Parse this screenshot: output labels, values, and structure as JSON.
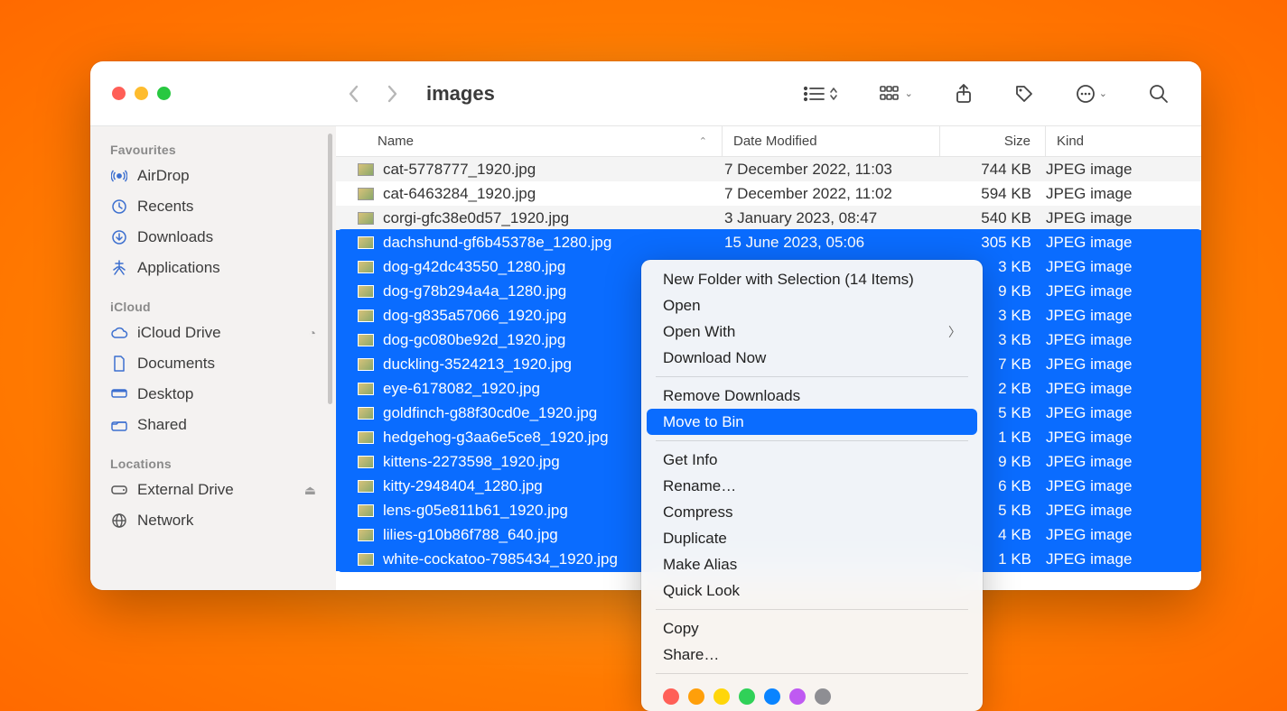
{
  "window": {
    "title": "images"
  },
  "columns": {
    "name": "Name",
    "date": "Date Modified",
    "size": "Size",
    "kind": "Kind"
  },
  "sidebar": {
    "favourites": {
      "header": "Favourites",
      "items": [
        {
          "label": "AirDrop",
          "icon": "airdrop"
        },
        {
          "label": "Recents",
          "icon": "clock"
        },
        {
          "label": "Downloads",
          "icon": "download"
        },
        {
          "label": "Applications",
          "icon": "apps"
        }
      ]
    },
    "icloud": {
      "header": "iCloud",
      "items": [
        {
          "label": "iCloud Drive",
          "icon": "cloud",
          "aux": "◔"
        },
        {
          "label": "Documents",
          "icon": "doc"
        },
        {
          "label": "Desktop",
          "icon": "desktop"
        },
        {
          "label": "Shared",
          "icon": "shared"
        }
      ]
    },
    "locations": {
      "header": "Locations",
      "items": [
        {
          "label": "External Drive",
          "icon": "drive",
          "aux": "⏏"
        },
        {
          "label": "Network",
          "icon": "globe"
        }
      ]
    }
  },
  "files": [
    {
      "name": "cat-5778777_1920.jpg",
      "date": "7 December 2022, 11:03",
      "size": "744 KB",
      "kind": "JPEG image",
      "sel": false,
      "alt": true
    },
    {
      "name": "cat-6463284_1920.jpg",
      "date": "7 December 2022, 11:02",
      "size": "594 KB",
      "kind": "JPEG image",
      "sel": false,
      "alt": false
    },
    {
      "name": "corgi-gfc38e0d57_1920.jpg",
      "date": "3 January 2023, 08:47",
      "size": "540 KB",
      "kind": "JPEG image",
      "sel": false,
      "alt": true
    },
    {
      "name": "dachshund-gf6b45378e_1280.jpg",
      "date": "15 June 2023, 05:06",
      "size": "305 KB",
      "kind": "JPEG image",
      "sel": true
    },
    {
      "name": "dog-g42dc43550_1280.jpg",
      "date": "",
      "size": "3 KB",
      "kind": "JPEG image",
      "sel": true
    },
    {
      "name": "dog-g78b294a4a_1280.jpg",
      "date": "",
      "size": "9 KB",
      "kind": "JPEG image",
      "sel": true
    },
    {
      "name": "dog-g835a57066_1920.jpg",
      "date": "",
      "size": "3 KB",
      "kind": "JPEG image",
      "sel": true
    },
    {
      "name": "dog-gc080be92d_1920.jpg",
      "date": "",
      "size": "3 KB",
      "kind": "JPEG image",
      "sel": true
    },
    {
      "name": "duckling-3524213_1920.jpg",
      "date": "",
      "size": "7 KB",
      "kind": "JPEG image",
      "sel": true
    },
    {
      "name": "eye-6178082_1920.jpg",
      "date": "",
      "size": "2 KB",
      "kind": "JPEG image",
      "sel": true
    },
    {
      "name": "goldfinch-g88f30cd0e_1920.jpg",
      "date": "",
      "size": "5 KB",
      "kind": "JPEG image",
      "sel": true
    },
    {
      "name": "hedgehog-g3aa6e5ce8_1920.jpg",
      "date": "",
      "size": "1 KB",
      "kind": "JPEG image",
      "sel": true
    },
    {
      "name": "kittens-2273598_1920.jpg",
      "date": "",
      "size": "9 KB",
      "kind": "JPEG image",
      "sel": true
    },
    {
      "name": "kitty-2948404_1280.jpg",
      "date": "",
      "size": "6 KB",
      "kind": "JPEG image",
      "sel": true
    },
    {
      "name": "lens-g05e811b61_1920.jpg",
      "date": "",
      "size": "5 KB",
      "kind": "JPEG image",
      "sel": true
    },
    {
      "name": "lilies-g10b86f788_640.jpg",
      "date": "",
      "size": "4 KB",
      "kind": "JPEG image",
      "sel": true
    },
    {
      "name": "white-cockatoo-7985434_1920.jpg",
      "date": "",
      "size": "1 KB",
      "kind": "JPEG image",
      "sel": true
    }
  ],
  "context_menu": {
    "groups": [
      [
        "New Folder with Selection (14 Items)",
        "Open",
        "Open With >",
        "Download Now"
      ],
      [
        "Remove Downloads",
        "Move to Bin"
      ],
      [
        "Get Info",
        "Rename…",
        "Compress",
        "Duplicate",
        "Make Alias",
        "Quick Look"
      ],
      [
        "Copy",
        "Share…"
      ]
    ],
    "highlighted": "Move to Bin",
    "tag_colors": [
      "#ff5f57",
      "#ff9f0a",
      "#ffd60a",
      "#30d158",
      "#0a84ff",
      "#bf5af2",
      "#8e8e93"
    ]
  }
}
